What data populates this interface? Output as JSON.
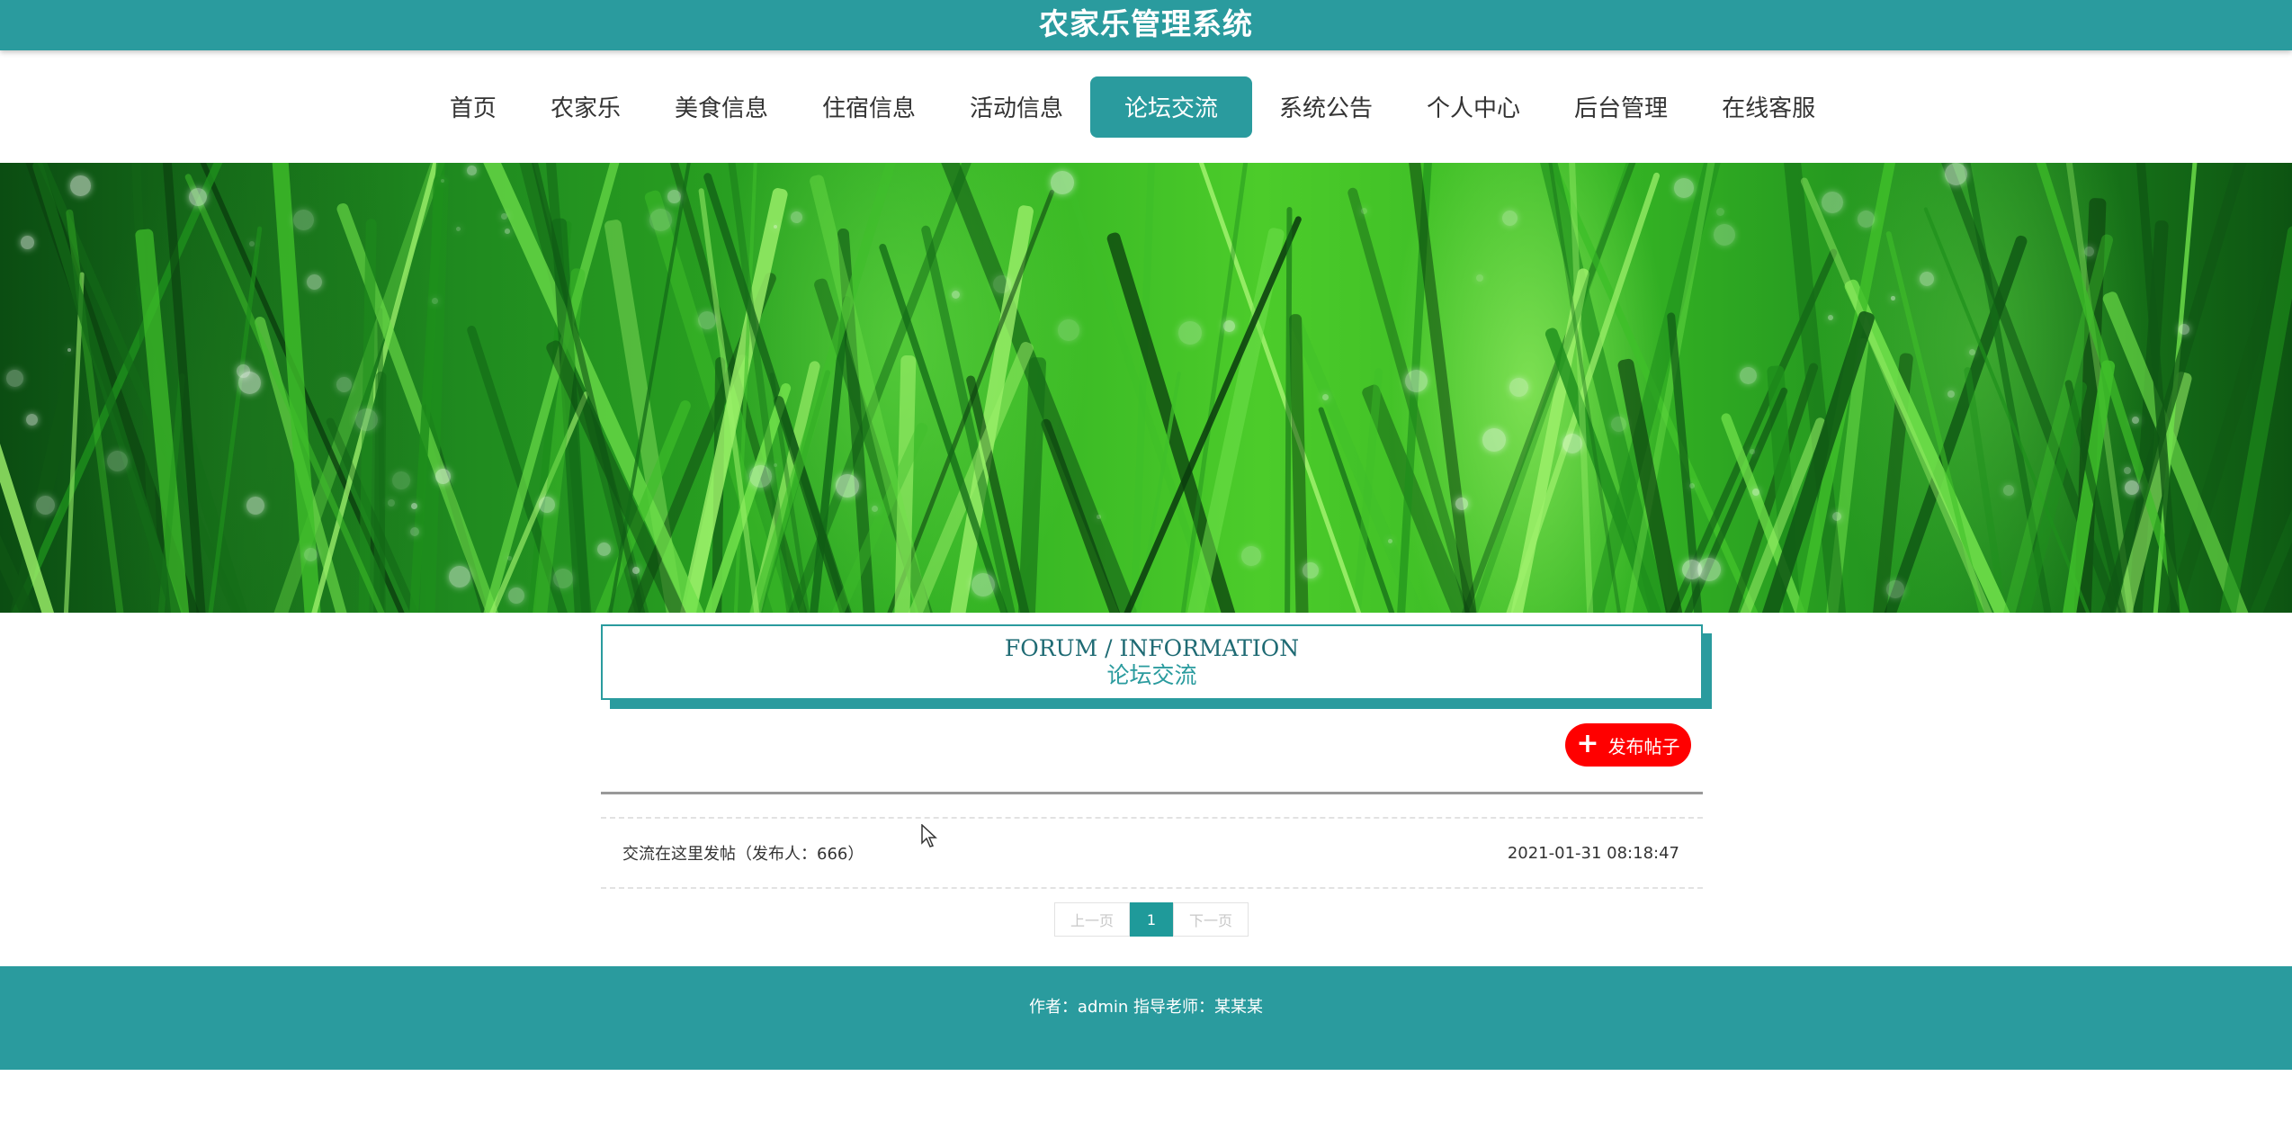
{
  "header": {
    "title": "农家乐管理系统"
  },
  "nav": {
    "items": [
      {
        "label": "首页"
      },
      {
        "label": "农家乐"
      },
      {
        "label": "美食信息"
      },
      {
        "label": "住宿信息"
      },
      {
        "label": "活动信息"
      },
      {
        "label": "论坛交流",
        "active": true
      },
      {
        "label": "系统公告"
      },
      {
        "label": "个人中心"
      },
      {
        "label": "后台管理"
      },
      {
        "label": "在线客服"
      }
    ]
  },
  "banner": {
    "slide_count": 3,
    "active_slide": 1
  },
  "section": {
    "title_en": "FORUM / INFORMATION",
    "title_cn": "论坛交流"
  },
  "actions": {
    "post_label": "发布帖子",
    "post_icon": "plus-icon"
  },
  "posts": [
    {
      "title": "交流在这里发帖（发布人：666）",
      "time": "2021-01-31 08:18:47"
    }
  ],
  "pagination": {
    "prev": "上一页",
    "current": "1",
    "next": "下一页"
  },
  "footer": {
    "text": "作者：admin 指导老师：某某某"
  },
  "colors": {
    "primary": "#2a9b9e",
    "post_button": "#ff0000",
    "page_active": "#1f9a9a"
  }
}
